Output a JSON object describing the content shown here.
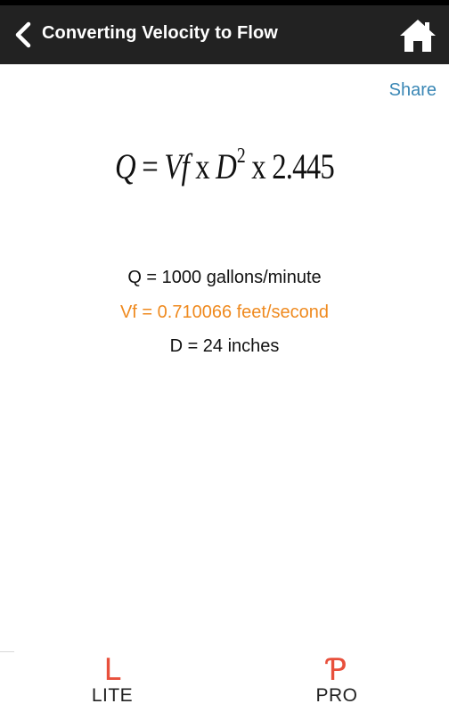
{
  "header": {
    "title": "Converting Velocity to Flow",
    "back_icon": "chevron-left-icon",
    "home_icon": "home-icon",
    "background": "#222222"
  },
  "share": {
    "label": "Share",
    "color": "#3a87b5"
  },
  "formula": {
    "lhs": "Q",
    "equals": " = ",
    "vf": "Vf",
    "times1": " x ",
    "d": "D",
    "exponent": "2",
    "times2": " x ",
    "constant": "2.445"
  },
  "results": {
    "q": "Q = 1000 gallons/minute",
    "vf": "Vf = 0.710066 feet/second",
    "d": "D = 24 inches",
    "highlight_color": "#ef8a1f"
  },
  "tabs": [
    {
      "icon": "L",
      "label": "LITE"
    },
    {
      "icon": "Ƥ",
      "label": "PRO"
    }
  ]
}
